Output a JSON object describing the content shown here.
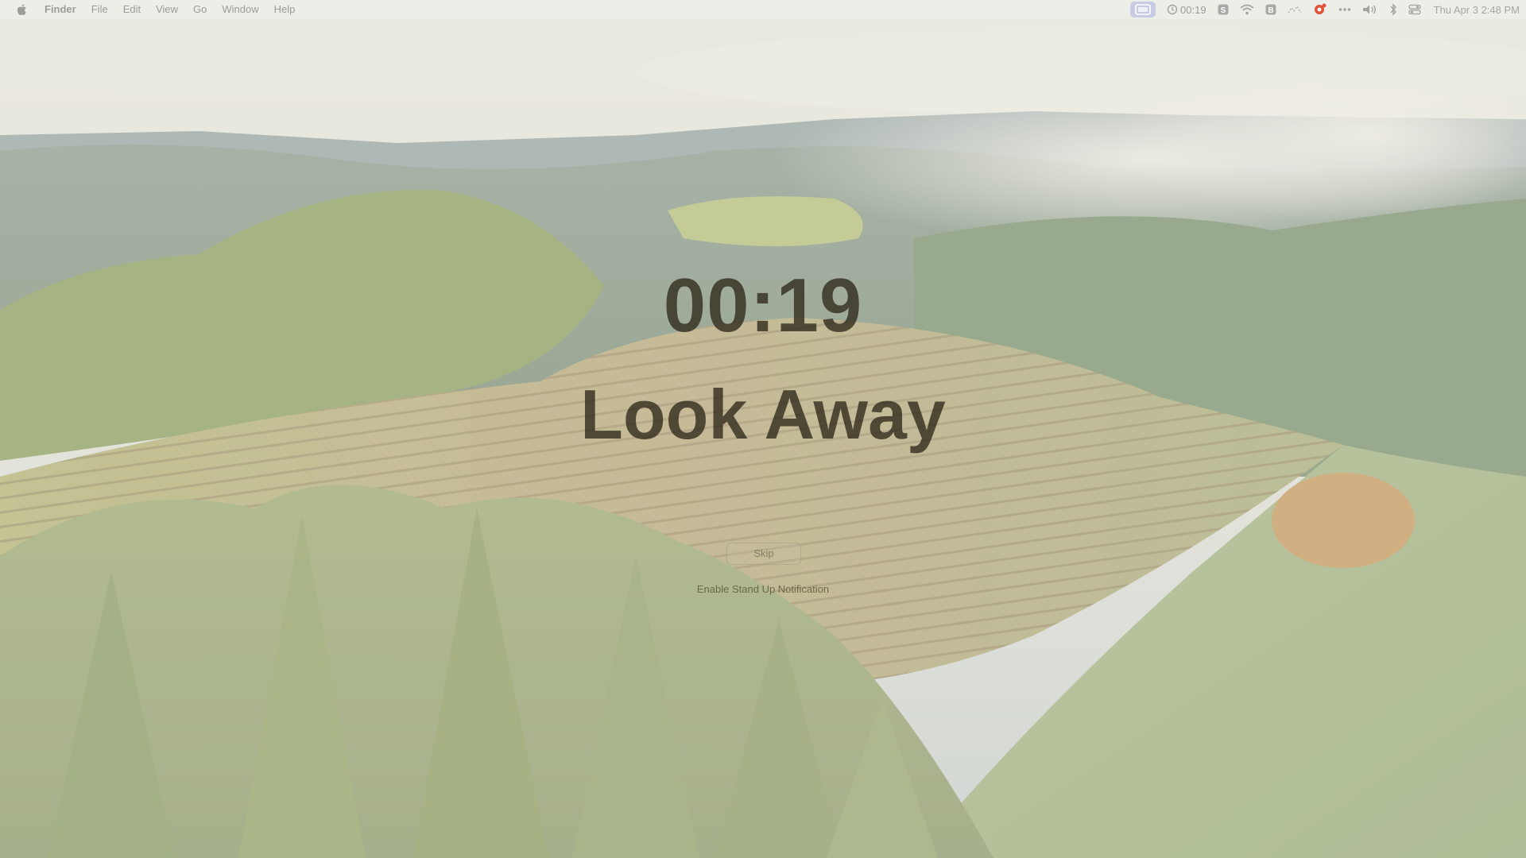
{
  "menubar": {
    "app_name": "Finder",
    "menus": [
      "File",
      "Edit",
      "View",
      "Go",
      "Window",
      "Help"
    ],
    "timer_text": "00:19",
    "clock": "Thu Apr 3  2:48 PM",
    "status_icons": [
      "screen-mirror-icon",
      "timer-icon",
      "s-app-icon",
      "wifi-icon",
      "b-app-icon",
      "focus-icon",
      "notification-app-icon",
      "more-icon",
      "volume-icon",
      "bluetooth-icon",
      "control-center-icon"
    ]
  },
  "break_screen": {
    "countdown": "00:19",
    "headline": "Look Away",
    "skip_label": "Skip",
    "standup_link": "Enable Stand Up Notification"
  },
  "colors": {
    "accent_notification": "#e0533a",
    "text_dark": "#2d2819",
    "highlight": "#9aa0dc"
  }
}
